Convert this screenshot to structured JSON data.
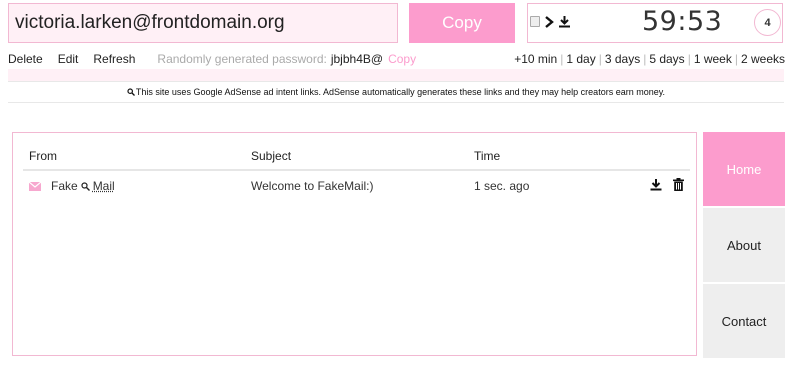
{
  "header": {
    "email": "victoria.larken@frontdomain.org",
    "copy_label": "Copy",
    "timer": "59:53",
    "count": "4"
  },
  "actions": {
    "delete_label": "Delete",
    "edit_label": "Edit",
    "refresh_label": "Refresh",
    "password_label": "Randomly generated password:",
    "password_value": "jbjbh4B@",
    "password_copy_label": "Copy"
  },
  "extend_options": [
    "+10 min",
    "1 day",
    "3 days",
    "5 days",
    "1 week",
    "2 weeks"
  ],
  "ad_notice": "This site uses Google AdSense ad intent links. AdSense automatically generates these links and they may help creators earn money.",
  "mail_table": {
    "columns": [
      "From",
      "Subject",
      "Time"
    ],
    "rows": [
      {
        "from_prefix": "Fake",
        "from_link": "Mail",
        "subject": "Welcome to FakeMail:)",
        "time": "1 sec. ago"
      }
    ]
  },
  "nav": [
    "Home",
    "About",
    "Contact"
  ],
  "colors": {
    "accent": "#fc9ccd",
    "light_pink": "#fff0f6",
    "border_pink": "#f2b8d2",
    "nav_grey": "#eeeeee"
  }
}
